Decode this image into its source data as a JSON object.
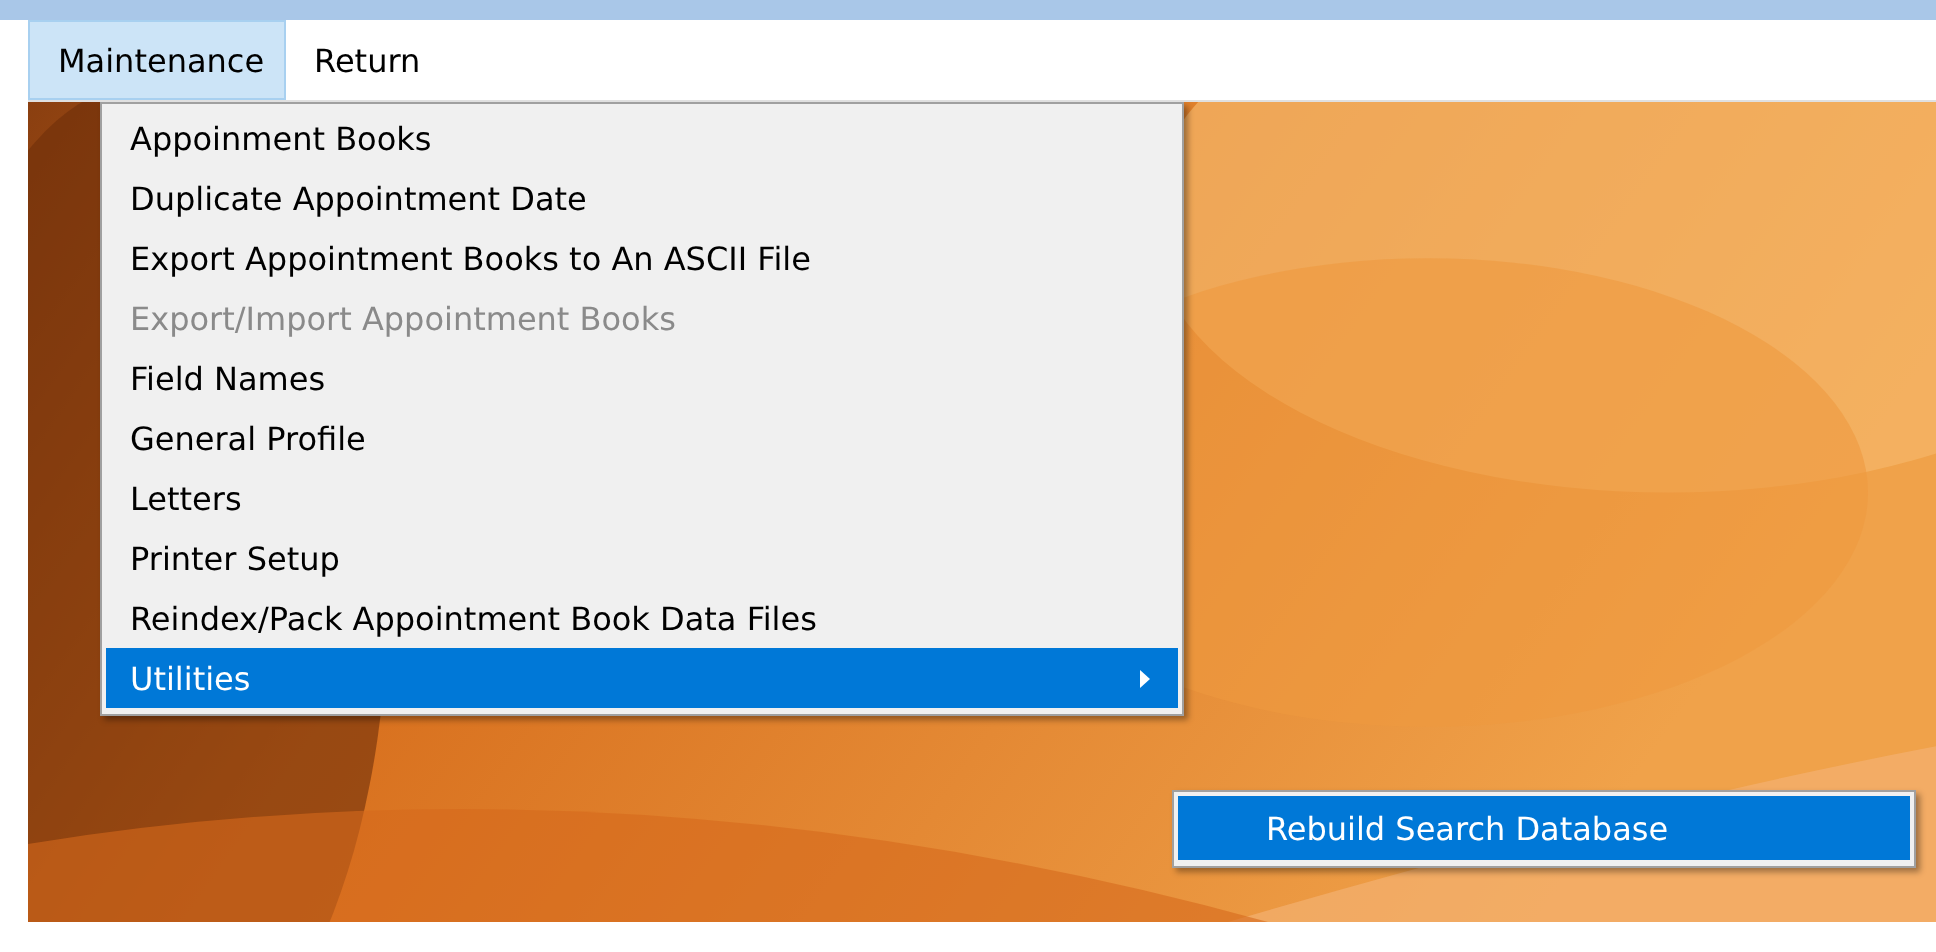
{
  "menu_bar": [
    {
      "label": "Maintenance",
      "selected": true
    },
    {
      "label": "Return",
      "selected": false
    }
  ],
  "menu": {
    "items": [
      {
        "label": "Appoinment Books",
        "disabled": false,
        "selected": false,
        "has_submenu": false
      },
      {
        "label": "Duplicate Appointment Date",
        "disabled": false,
        "selected": false,
        "has_submenu": false
      },
      {
        "label": "Export Appointment Books to An ASCII File",
        "disabled": false,
        "selected": false,
        "has_submenu": false
      },
      {
        "label": "Export/Import Appointment Books",
        "disabled": true,
        "selected": false,
        "has_submenu": false
      },
      {
        "label": "Field Names",
        "disabled": false,
        "selected": false,
        "has_submenu": false
      },
      {
        "label": "General Profile",
        "disabled": false,
        "selected": false,
        "has_submenu": false
      },
      {
        "label": "Letters",
        "disabled": false,
        "selected": false,
        "has_submenu": false
      },
      {
        "label": "Printer Setup",
        "disabled": false,
        "selected": false,
        "has_submenu": false
      },
      {
        "label": "Reindex/Pack Appointment Book Data Files",
        "disabled": false,
        "selected": false,
        "has_submenu": false
      },
      {
        "label": "Utilities",
        "disabled": false,
        "selected": true,
        "has_submenu": true
      }
    ]
  },
  "submenu": {
    "items": [
      {
        "label": "Rebuild Search Database",
        "disabled": false,
        "selected": true
      }
    ]
  }
}
